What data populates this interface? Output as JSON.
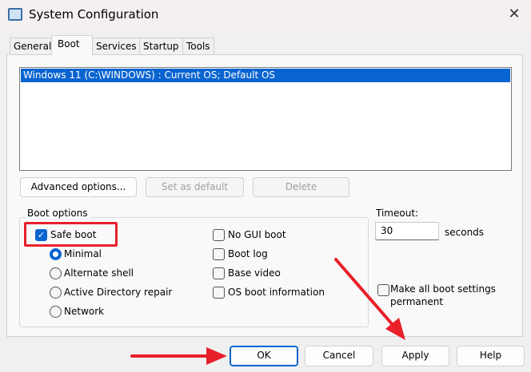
{
  "window": {
    "title": "System Configuration",
    "close": "✕"
  },
  "tabs": [
    "General",
    "Boot",
    "Services",
    "Startup",
    "Tools"
  ],
  "boot_list": [
    "Windows 11 (C:\\WINDOWS) : Current OS; Default OS"
  ],
  "list_buttons": {
    "advanced": "Advanced options...",
    "set_default": "Set as default",
    "delete": "Delete"
  },
  "boot_options": {
    "label": "Boot options",
    "safe_boot": "Safe boot",
    "minimal": "Minimal",
    "alternate_shell": "Alternate shell",
    "ad_repair": "Active Directory repair",
    "network": "Network",
    "no_gui": "No GUI boot",
    "boot_log": "Boot log",
    "base_video": "Base video",
    "os_info": "OS boot information"
  },
  "timeout": {
    "label": "Timeout:",
    "value": "30",
    "unit": "seconds"
  },
  "make_permanent": {
    "line1": "Make all boot settings",
    "line2": "permanent"
  },
  "footer": {
    "ok": "OK",
    "cancel": "Cancel",
    "apply": "Apply",
    "help": "Help"
  },
  "annotation_color": "#e8202a"
}
